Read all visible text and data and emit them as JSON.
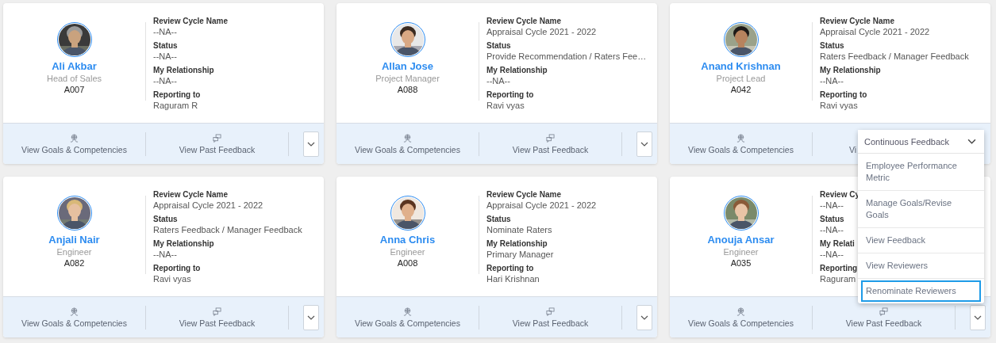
{
  "cards": [
    {
      "name": "Ali Akbar",
      "title": "Head of Sales",
      "employee_id": "A007",
      "avatar": {
        "kind": "picture"
      },
      "fields": [
        {
          "label": "Review Cycle Name",
          "value": "--NA--"
        },
        {
          "label": "Status",
          "value": "--NA--"
        },
        {
          "label": "My Relationship",
          "value": "--NA--"
        },
        {
          "label": "Reporting to",
          "value": "Raguram R"
        }
      ],
      "actions": [
        {
          "label": "View Goals & Competencies",
          "kind": "goals"
        },
        {
          "label": "View Past Feedback",
          "kind": "feedback"
        }
      ],
      "menu_button": true
    },
    {
      "name": "Allan Jose",
      "title": "Project Manager",
      "employee_id": "A088",
      "avatar": {
        "kind": "picture"
      },
      "fields": [
        {
          "label": "Review Cycle Name",
          "value": "Appraisal Cycle 2021 - 2022"
        },
        {
          "label": "Status",
          "value": "Provide Recommendation / Raters Fee…"
        },
        {
          "label": "My Relationship",
          "value": "--NA--"
        },
        {
          "label": "Reporting to",
          "value": "Ravi vyas"
        }
      ],
      "actions": [
        {
          "label": "View Goals & Competencies",
          "kind": "goals"
        },
        {
          "label": "View Past Feedback",
          "kind": "feedback"
        }
      ],
      "menu_button": true
    },
    {
      "name": "Anand Krishnan",
      "title": "Project Lead",
      "employee_id": "A042",
      "avatar": {
        "kind": "picture"
      },
      "fields": [
        {
          "label": "Review Cycle Name",
          "value": "Appraisal Cycle 2021 - 2022"
        },
        {
          "label": "Status",
          "value": "Raters Feedback / Manager Feedback"
        },
        {
          "label": "My Relationship",
          "value": "--NA--"
        },
        {
          "label": "Reporting to",
          "value": "Ravi vyas"
        }
      ],
      "actions": [
        {
          "label": "View Goals & Competencies",
          "kind": "goals"
        },
        {
          "label": "Vi",
          "kind": "cut"
        }
      ],
      "menu_button": false
    },
    {
      "name": "Anjali Nair",
      "title": "Engineer",
      "employee_id": "A082",
      "avatar": {
        "kind": "picture"
      },
      "fields": [
        {
          "label": "Review Cycle Name",
          "value": "Appraisal Cycle 2021 - 2022"
        },
        {
          "label": "Status",
          "value": "Raters Feedback / Manager Feedback"
        },
        {
          "label": "My Relationship",
          "value": "--NA--"
        },
        {
          "label": "Reporting to",
          "value": "Ravi vyas"
        }
      ],
      "actions": [
        {
          "label": "View Goals & Competencies",
          "kind": "goals"
        },
        {
          "label": "View Past Feedback",
          "kind": "feedback"
        }
      ],
      "menu_button": true
    },
    {
      "name": "Anna Chris",
      "title": "Engineer",
      "employee_id": "A008",
      "avatar": {
        "kind": "picture"
      },
      "fields": [
        {
          "label": "Review Cycle Name",
          "value": "Appraisal Cycle 2021 - 2022"
        },
        {
          "label": "Status",
          "value": "Nominate Raters"
        },
        {
          "label": "My Relationship",
          "value": "Primary Manager"
        },
        {
          "label": "Reporting to",
          "value": "Hari Krishnan"
        }
      ],
      "actions": [
        {
          "label": "View Goals & Competencies",
          "kind": "goals"
        },
        {
          "label": "View Past Feedback",
          "kind": "feedback"
        }
      ],
      "menu_button": true
    },
    {
      "name": "Anouja Ansar",
      "title": "Engineer",
      "employee_id": "A035",
      "avatar": {
        "kind": "picture"
      },
      "fields": [
        {
          "label": "Review Cy",
          "value": "--NA--"
        },
        {
          "label": "Status",
          "value": "--NA--"
        },
        {
          "label": "My Relati",
          "value": "--NA--"
        },
        {
          "label": "Reporting",
          "value": "Raguram"
        }
      ],
      "actions": [
        {
          "label": "View Goals & Competencies",
          "kind": "goals"
        },
        {
          "label": "View Past Feedback",
          "kind": "feedback"
        }
      ],
      "menu_button": true
    }
  ],
  "menu": {
    "title": "Continuous Feedback",
    "items": [
      {
        "label": "Employee Performance Metric",
        "selected": false
      },
      {
        "label": "Manage Goals/Revise Goals",
        "selected": false
      },
      {
        "label": "View Feedback",
        "selected": false
      },
      {
        "label": "View Reviewers",
        "selected": false
      },
      {
        "label": "Renominate Reviewers",
        "selected": true
      }
    ]
  }
}
